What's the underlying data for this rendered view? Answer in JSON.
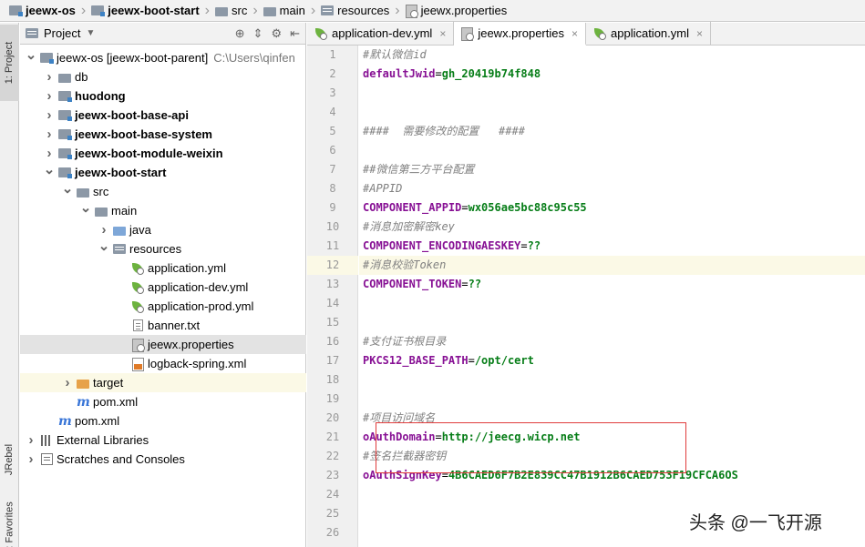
{
  "navbar": {
    "crumbs": [
      {
        "label": "jeewx-os",
        "icon": "project-folder-icon",
        "bold": true
      },
      {
        "label": "jeewx-boot-start",
        "icon": "module-folder-icon",
        "bold": true
      },
      {
        "label": "src",
        "icon": "folder-icon",
        "bold": false
      },
      {
        "label": "main",
        "icon": "folder-icon",
        "bold": false
      },
      {
        "label": "resources",
        "icon": "resources-folder-icon",
        "bold": false
      },
      {
        "label": "jeewx.properties",
        "icon": "properties-file-icon",
        "bold": false
      }
    ]
  },
  "left_toolbar": {
    "project_tab": "1: Project",
    "jrebel_tab": "JRebel",
    "favorites_tab": "2: Favorites"
  },
  "project_panel": {
    "title": "Project",
    "tree": [
      {
        "label": "jeewx-os [jeewx-boot-parent]",
        "extra": "C:\\Users\\qinfen",
        "icon": "module-folder-icon",
        "arrow": "down",
        "bold": false,
        "level": 0
      },
      {
        "label": "db",
        "icon": "folder-icon",
        "arrow": "right",
        "bold": false,
        "level": 1
      },
      {
        "label": "huodong",
        "icon": "module-folder-icon",
        "arrow": "right",
        "bold": true,
        "level": 1
      },
      {
        "label": "jeewx-boot-base-api",
        "icon": "module-folder-icon",
        "arrow": "right",
        "bold": true,
        "level": 1
      },
      {
        "label": "jeewx-boot-base-system",
        "icon": "module-folder-icon",
        "arrow": "right",
        "bold": true,
        "level": 1
      },
      {
        "label": "jeewx-boot-module-weixin",
        "icon": "module-folder-icon",
        "arrow": "right",
        "bold": true,
        "level": 1
      },
      {
        "label": "jeewx-boot-start",
        "icon": "module-folder-icon",
        "arrow": "down",
        "bold": true,
        "level": 1
      },
      {
        "label": "src",
        "icon": "folder-icon",
        "arrow": "down",
        "bold": false,
        "level": 2
      },
      {
        "label": "main",
        "icon": "folder-icon",
        "arrow": "down",
        "bold": false,
        "level": 3
      },
      {
        "label": "java",
        "icon": "source-folder-icon",
        "arrow": "right",
        "bold": false,
        "level": 4
      },
      {
        "label": "resources",
        "icon": "resources-folder-icon",
        "arrow": "down",
        "bold": false,
        "level": 4
      },
      {
        "label": "application.yml",
        "icon": "spring-leaf-icon",
        "arrow": "",
        "bold": false,
        "level": 5
      },
      {
        "label": "application-dev.yml",
        "icon": "spring-leaf-icon",
        "arrow": "",
        "bold": false,
        "level": 5
      },
      {
        "label": "application-prod.yml",
        "icon": "spring-leaf-icon",
        "arrow": "",
        "bold": false,
        "level": 5
      },
      {
        "label": "banner.txt",
        "icon": "text-file-icon",
        "arrow": "",
        "bold": false,
        "level": 5
      },
      {
        "label": "jeewx.properties",
        "icon": "properties-file-icon",
        "arrow": "",
        "bold": false,
        "level": 5,
        "selected": true
      },
      {
        "label": "logback-spring.xml",
        "icon": "xml-file-icon",
        "arrow": "",
        "bold": false,
        "level": 5
      },
      {
        "label": "target",
        "icon": "target-folder-icon",
        "arrow": "right",
        "bold": false,
        "level": 2,
        "highlight": true
      },
      {
        "label": "pom.xml",
        "icon": "maven-icon",
        "arrow": "",
        "bold": false,
        "level": 2
      },
      {
        "label": "pom.xml",
        "icon": "maven-icon",
        "arrow": "",
        "bold": false,
        "level": 1
      },
      {
        "label": "External Libraries",
        "icon": "library-icon",
        "arrow": "right",
        "bold": false,
        "level": 0
      },
      {
        "label": "Scratches and Consoles",
        "icon": "scratch-icon",
        "arrow": "right",
        "bold": false,
        "level": 0
      }
    ]
  },
  "editor": {
    "tabs": [
      {
        "label": "application-dev.yml",
        "icon": "spring-leaf-icon",
        "active": false
      },
      {
        "label": "jeewx.properties",
        "icon": "properties-file-icon",
        "active": true
      },
      {
        "label": "application.yml",
        "icon": "spring-leaf-icon",
        "active": false
      }
    ],
    "current_line": 12,
    "lines": [
      {
        "n": "1",
        "parts": [
          {
            "t": "#默认微信id",
            "c": "comment"
          }
        ]
      },
      {
        "n": "2",
        "parts": [
          {
            "t": "defaultJwid",
            "c": "key"
          },
          {
            "t": "=",
            "c": "eq"
          },
          {
            "t": "gh_20419b74f848",
            "c": "val"
          }
        ]
      },
      {
        "n": "3",
        "parts": []
      },
      {
        "n": "4",
        "parts": []
      },
      {
        "n": "5",
        "parts": [
          {
            "t": "####  需要修改的配置   ####",
            "c": "comment"
          }
        ]
      },
      {
        "n": "6",
        "parts": []
      },
      {
        "n": "7",
        "parts": [
          {
            "t": "##微信第三方平台配置",
            "c": "comment"
          }
        ]
      },
      {
        "n": "8",
        "parts": [
          {
            "t": "#APPID",
            "c": "comment"
          }
        ]
      },
      {
        "n": "9",
        "parts": [
          {
            "t": "COMPONENT_APPID",
            "c": "key"
          },
          {
            "t": "=",
            "c": "eq"
          },
          {
            "t": "wx056ae5bc88c95c55",
            "c": "val"
          }
        ]
      },
      {
        "n": "10",
        "parts": [
          {
            "t": "#消息加密解密key",
            "c": "comment"
          }
        ]
      },
      {
        "n": "11",
        "parts": [
          {
            "t": "COMPONENT_ENCODINGAESKEY",
            "c": "key"
          },
          {
            "t": "=",
            "c": "eq"
          },
          {
            "t": "??",
            "c": "val"
          }
        ]
      },
      {
        "n": "12",
        "parts": [
          {
            "t": "#消息校验Token",
            "c": "comment"
          }
        ]
      },
      {
        "n": "13",
        "parts": [
          {
            "t": "COMPONENT_TOKEN",
            "c": "key"
          },
          {
            "t": "=",
            "c": "eq"
          },
          {
            "t": "??",
            "c": "val"
          }
        ]
      },
      {
        "n": "14",
        "parts": []
      },
      {
        "n": "15",
        "parts": []
      },
      {
        "n": "16",
        "parts": [
          {
            "t": "#支付证书根目录",
            "c": "comment"
          }
        ]
      },
      {
        "n": "17",
        "parts": [
          {
            "t": "PKCS12_BASE_PATH",
            "c": "key"
          },
          {
            "t": "=",
            "c": "eq"
          },
          {
            "t": "/opt/cert",
            "c": "val"
          }
        ]
      },
      {
        "n": "18",
        "parts": []
      },
      {
        "n": "19",
        "parts": []
      },
      {
        "n": "20",
        "parts": [
          {
            "t": "#项目访问域名",
            "c": "comment"
          }
        ]
      },
      {
        "n": "21",
        "parts": [
          {
            "t": "oAuthDomain",
            "c": "key"
          },
          {
            "t": "=",
            "c": "eq"
          },
          {
            "t": "http://jeecg.wicp.net",
            "c": "val"
          }
        ]
      },
      {
        "n": "22",
        "parts": [
          {
            "t": "#签名拦截器密钥",
            "c": "comment"
          }
        ]
      },
      {
        "n": "23",
        "parts": [
          {
            "t": "oAuthSignKey",
            "c": "key"
          },
          {
            "t": "=",
            "c": "eq"
          },
          {
            "t": "4B6CAED6F7B2E839CC47B1912B6CAED753F19CFCA6OS",
            "c": "val"
          }
        ]
      },
      {
        "n": "24",
        "parts": []
      },
      {
        "n": "25",
        "parts": []
      },
      {
        "n": "26",
        "parts": []
      }
    ]
  },
  "watermark": "头条 @一飞开源",
  "colors": {
    "highlight_box": "#e03c3c",
    "key": "#871094",
    "value": "#067d17",
    "comment": "#808080",
    "current_line": "#fbf9e6"
  }
}
